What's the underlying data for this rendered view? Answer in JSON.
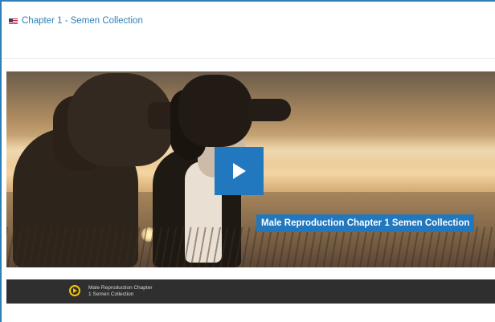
{
  "header": {
    "flag_icon": "us-flag-icon",
    "title": "Chapter 1 - Semen Collection"
  },
  "video": {
    "caption": "Male Reproduction Chapter 1 Semen Collection",
    "play_icon": "play-icon",
    "accent_color": "#2278be"
  },
  "footer": {
    "icon": "play-circle-icon",
    "line1": "Male Reproduction Chapter",
    "line2": "1 Semen Collection"
  }
}
